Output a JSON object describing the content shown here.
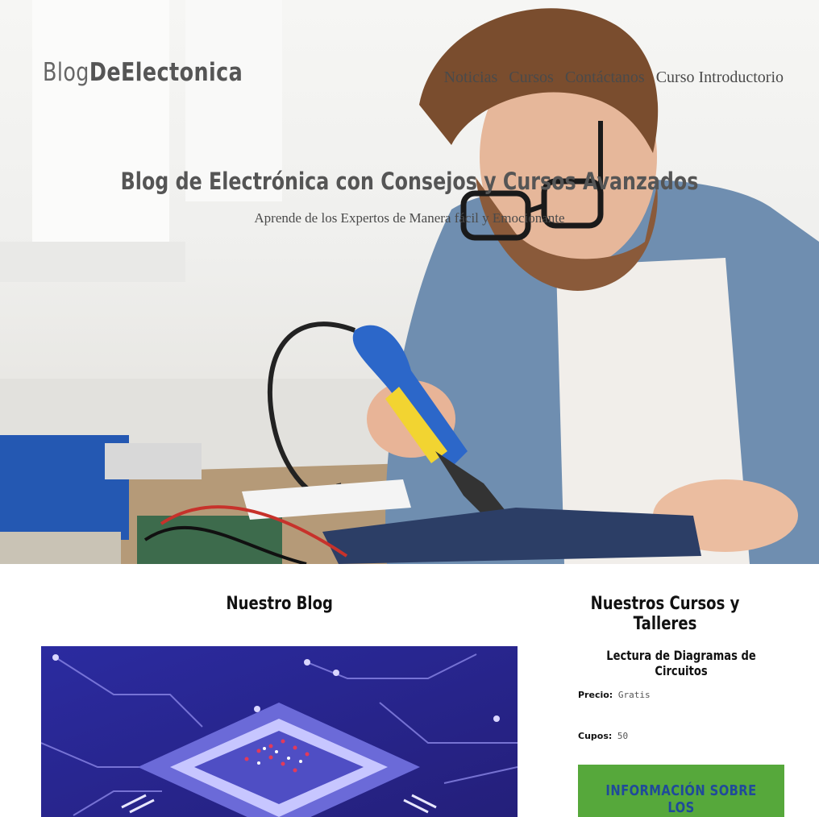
{
  "header": {
    "logo_light": "Blog",
    "logo_bold": "DeElectonica",
    "nav": [
      "Noticias",
      "Cursos",
      "Contáctanos",
      "Curso Introductorio"
    ]
  },
  "hero": {
    "title": "Blog de Electrónica con Consejos y Cursos Avanzados",
    "subtitle": "Aprende de los Expertos de Manera fácil y Emocionante"
  },
  "blog": {
    "heading": "Nuestro Blog"
  },
  "courses": {
    "heading": "Nuestros Cursos y Talleres",
    "course_title": "Lectura de Diagramas de Circuitos",
    "price_label": "Precio:",
    "price_value": "Gratis",
    "seats_label": "Cupos:",
    "seats_value": "50",
    "button_label": "INFORMACIÓN SOBRE LOS"
  },
  "colors": {
    "button_bg": "#56a83b",
    "button_text": "#1f4a9a",
    "blog_image_bg": "#2a2a8e"
  }
}
